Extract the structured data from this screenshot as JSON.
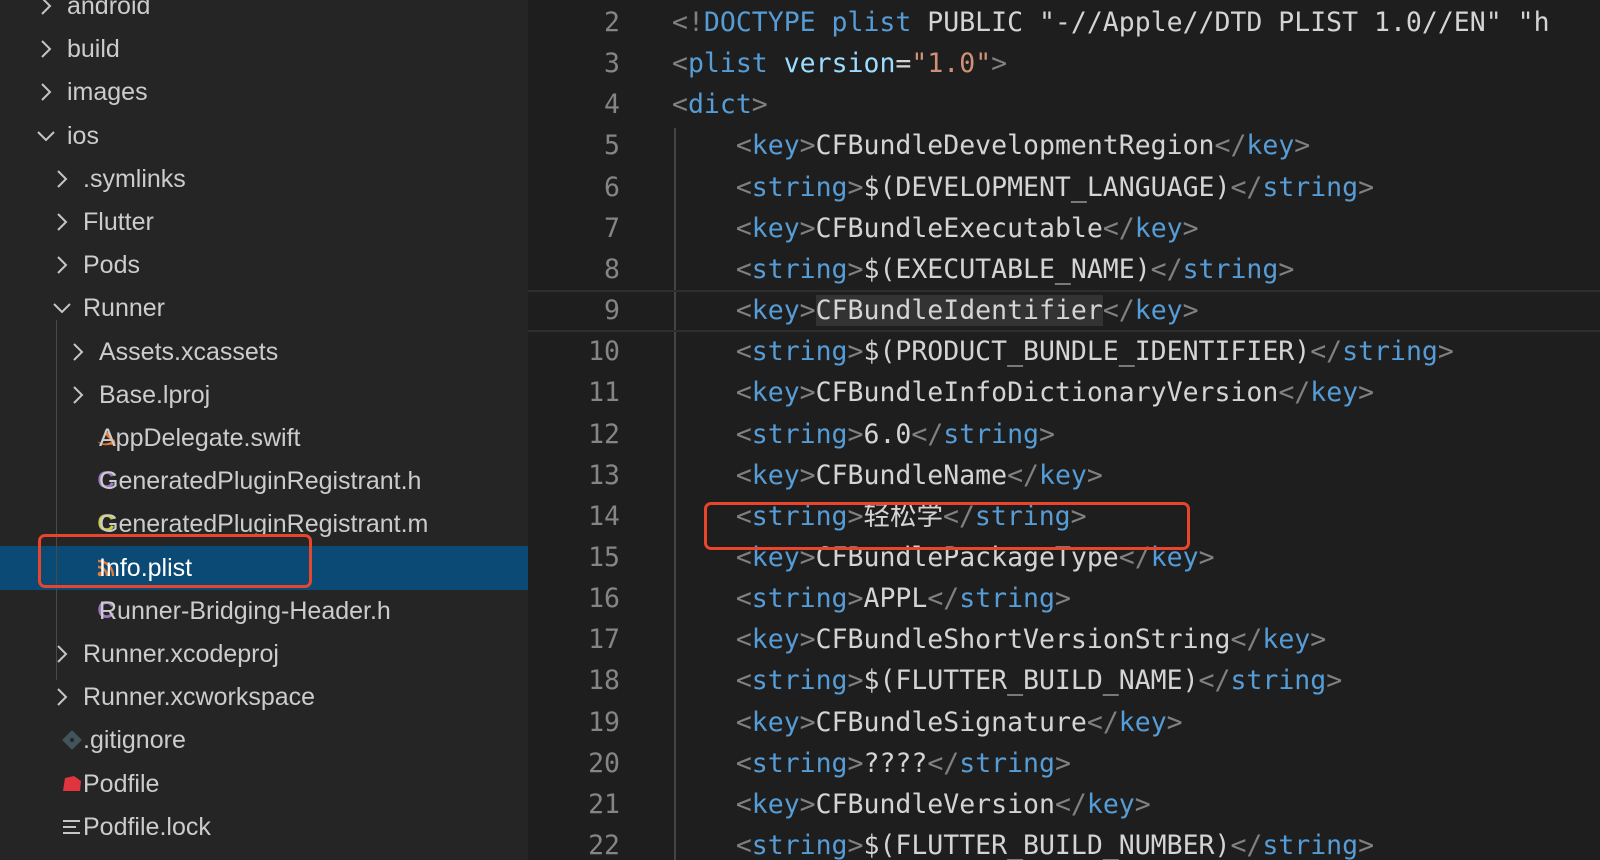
{
  "explorer": {
    "items": [
      {
        "label": "android",
        "kind": "folder",
        "state": "collapsed",
        "depth": 0
      },
      {
        "label": "build",
        "kind": "folder",
        "state": "collapsed",
        "depth": 0
      },
      {
        "label": "images",
        "kind": "folder",
        "state": "collapsed",
        "depth": 0
      },
      {
        "label": "ios",
        "kind": "folder",
        "state": "expanded",
        "depth": 0
      },
      {
        "label": ".symlinks",
        "kind": "folder",
        "state": "collapsed",
        "depth": 1
      },
      {
        "label": "Flutter",
        "kind": "folder",
        "state": "collapsed",
        "depth": 1
      },
      {
        "label": "Pods",
        "kind": "folder",
        "state": "collapsed",
        "depth": 1
      },
      {
        "label": "Runner",
        "kind": "folder",
        "state": "expanded",
        "depth": 1
      },
      {
        "label": "Assets.xcassets",
        "kind": "folder",
        "state": "collapsed",
        "depth": 2
      },
      {
        "label": "Base.lproj",
        "kind": "folder",
        "state": "collapsed",
        "depth": 2
      },
      {
        "label": "AppDelegate.swift",
        "kind": "swift",
        "depth": 2
      },
      {
        "label": "GeneratedPluginRegistrant.h",
        "kind": "c-header",
        "depth": 2
      },
      {
        "label": "GeneratedPluginRegistrant.m",
        "kind": "c-source",
        "depth": 2
      },
      {
        "label": "Info.plist",
        "kind": "plist",
        "depth": 2,
        "selected": true
      },
      {
        "label": "Runner-Bridging-Header.h",
        "kind": "c-header",
        "depth": 2
      },
      {
        "label": "Runner.xcodeproj",
        "kind": "folder",
        "state": "collapsed",
        "depth": 1
      },
      {
        "label": "Runner.xcworkspace",
        "kind": "folder",
        "state": "collapsed",
        "depth": 1
      },
      {
        "label": ".gitignore",
        "kind": "git",
        "depth": 1
      },
      {
        "label": "Podfile",
        "kind": "ruby",
        "depth": 1
      },
      {
        "label": "Podfile.lock",
        "kind": "lines",
        "depth": 1
      }
    ]
  },
  "icons": {
    "chevron_right": "chevron-right-icon",
    "chevron_down": "chevron-down-icon",
    "swift": "swift-icon",
    "c_file": "c-file-icon",
    "rss": "rss-icon",
    "git": "git-icon",
    "ruby": "ruby-icon",
    "lines": "lines-icon"
  },
  "colors": {
    "sidebar_bg": "#252526",
    "editor_bg": "#1e1e1e",
    "selection_bg": "#0a4a75",
    "highlight_box": "#e8452c",
    "tag": "#569cd6",
    "punct": "#808080",
    "text": "#d4d4d4",
    "attr": "#9cdcfe",
    "string": "#ce9178",
    "c_header_icon": "#a074c4",
    "c_source_icon": "#cbcb41",
    "swift_icon": "#e37933",
    "ruby_icon": "#e0343e"
  },
  "editor": {
    "current_line": 9,
    "lines": [
      {
        "n": "2",
        "tokens": [
          {
            "t": "<!",
            "c": "p"
          },
          {
            "t": "DOCTYPE plist",
            "c": "t"
          },
          {
            "t": " PUBLIC \"-//Apple//DTD PLIST 1.0//EN\" \"",
            "c": "tx"
          },
          {
            "t": "h",
            "c": "tx"
          }
        ]
      },
      {
        "n": "3",
        "tokens": [
          {
            "t": "<",
            "c": "p"
          },
          {
            "t": "plist",
            "c": "t"
          },
          {
            "t": " ",
            "c": "tx"
          },
          {
            "t": "version",
            "c": "at"
          },
          {
            "t": "=",
            "c": "tx"
          },
          {
            "t": "\"1.0\"",
            "c": "s"
          },
          {
            "t": ">",
            "c": "p"
          }
        ]
      },
      {
        "n": "4",
        "tokens": [
          {
            "t": "<",
            "c": "p"
          },
          {
            "t": "dict",
            "c": "t"
          },
          {
            "t": ">",
            "c": "p"
          }
        ]
      },
      {
        "n": "5",
        "tokens": [
          {
            "t": "    <",
            "c": "p"
          },
          {
            "t": "key",
            "c": "t"
          },
          {
            "t": ">",
            "c": "p"
          },
          {
            "t": "CFBundleDevelopmentRegion",
            "c": "tx"
          },
          {
            "t": "</",
            "c": "p"
          },
          {
            "t": "key",
            "c": "t"
          },
          {
            "t": ">",
            "c": "p"
          }
        ]
      },
      {
        "n": "6",
        "tokens": [
          {
            "t": "    <",
            "c": "p"
          },
          {
            "t": "string",
            "c": "t"
          },
          {
            "t": ">",
            "c": "p"
          },
          {
            "t": "$(DEVELOPMENT_LANGUAGE)",
            "c": "tx"
          },
          {
            "t": "</",
            "c": "p"
          },
          {
            "t": "string",
            "c": "t"
          },
          {
            "t": ">",
            "c": "p"
          }
        ]
      },
      {
        "n": "7",
        "tokens": [
          {
            "t": "    <",
            "c": "p"
          },
          {
            "t": "key",
            "c": "t"
          },
          {
            "t": ">",
            "c": "p"
          },
          {
            "t": "CFBundleExecutable",
            "c": "tx"
          },
          {
            "t": "</",
            "c": "p"
          },
          {
            "t": "key",
            "c": "t"
          },
          {
            "t": ">",
            "c": "p"
          }
        ]
      },
      {
        "n": "8",
        "tokens": [
          {
            "t": "    <",
            "c": "p"
          },
          {
            "t": "string",
            "c": "t"
          },
          {
            "t": ">",
            "c": "p"
          },
          {
            "t": "$(EXECUTABLE_NAME)",
            "c": "tx"
          },
          {
            "t": "</",
            "c": "p"
          },
          {
            "t": "string",
            "c": "t"
          },
          {
            "t": ">",
            "c": "p"
          }
        ]
      },
      {
        "n": "9",
        "tokens": [
          {
            "t": "    <",
            "c": "p"
          },
          {
            "t": "key",
            "c": "t"
          },
          {
            "t": ">",
            "c": "p"
          },
          {
            "t": "CFBundleIdentifier",
            "c": "tx",
            "sel": true
          },
          {
            "t": "</",
            "c": "p"
          },
          {
            "t": "key",
            "c": "t"
          },
          {
            "t": ">",
            "c": "p"
          }
        ]
      },
      {
        "n": "10",
        "tokens": [
          {
            "t": "    <",
            "c": "p"
          },
          {
            "t": "string",
            "c": "t"
          },
          {
            "t": ">",
            "c": "p"
          },
          {
            "t": "$(PRODUCT_BUNDLE_IDENTIFIER)",
            "c": "tx"
          },
          {
            "t": "</",
            "c": "p"
          },
          {
            "t": "string",
            "c": "t"
          },
          {
            "t": ">",
            "c": "p"
          }
        ]
      },
      {
        "n": "11",
        "tokens": [
          {
            "t": "    <",
            "c": "p"
          },
          {
            "t": "key",
            "c": "t"
          },
          {
            "t": ">",
            "c": "p"
          },
          {
            "t": "CFBundleInfoDictionaryVersion",
            "c": "tx"
          },
          {
            "t": "</",
            "c": "p"
          },
          {
            "t": "key",
            "c": "t"
          },
          {
            "t": ">",
            "c": "p"
          }
        ]
      },
      {
        "n": "12",
        "tokens": [
          {
            "t": "    <",
            "c": "p"
          },
          {
            "t": "string",
            "c": "t"
          },
          {
            "t": ">",
            "c": "p"
          },
          {
            "t": "6.0",
            "c": "tx"
          },
          {
            "t": "</",
            "c": "p"
          },
          {
            "t": "string",
            "c": "t"
          },
          {
            "t": ">",
            "c": "p"
          }
        ]
      },
      {
        "n": "13",
        "tokens": [
          {
            "t": "    <",
            "c": "p"
          },
          {
            "t": "key",
            "c": "t"
          },
          {
            "t": ">",
            "c": "p"
          },
          {
            "t": "CFBundleName",
            "c": "tx"
          },
          {
            "t": "</",
            "c": "p"
          },
          {
            "t": "key",
            "c": "t"
          },
          {
            "t": ">",
            "c": "p"
          }
        ]
      },
      {
        "n": "14",
        "tokens": [
          {
            "t": "    <",
            "c": "p"
          },
          {
            "t": "string",
            "c": "t"
          },
          {
            "t": ">",
            "c": "p"
          },
          {
            "t": "轻松学",
            "c": "tx"
          },
          {
            "t": "</",
            "c": "p"
          },
          {
            "t": "string",
            "c": "t"
          },
          {
            "t": ">",
            "c": "p"
          }
        ]
      },
      {
        "n": "15",
        "tokens": [
          {
            "t": "    <",
            "c": "p"
          },
          {
            "t": "key",
            "c": "t"
          },
          {
            "t": ">",
            "c": "p"
          },
          {
            "t": "CFBundlePackageType",
            "c": "tx"
          },
          {
            "t": "</",
            "c": "p"
          },
          {
            "t": "key",
            "c": "t"
          },
          {
            "t": ">",
            "c": "p"
          }
        ]
      },
      {
        "n": "16",
        "tokens": [
          {
            "t": "    <",
            "c": "p"
          },
          {
            "t": "string",
            "c": "t"
          },
          {
            "t": ">",
            "c": "p"
          },
          {
            "t": "APPL",
            "c": "tx"
          },
          {
            "t": "</",
            "c": "p"
          },
          {
            "t": "string",
            "c": "t"
          },
          {
            "t": ">",
            "c": "p"
          }
        ]
      },
      {
        "n": "17",
        "tokens": [
          {
            "t": "    <",
            "c": "p"
          },
          {
            "t": "key",
            "c": "t"
          },
          {
            "t": ">",
            "c": "p"
          },
          {
            "t": "CFBundleShortVersionString",
            "c": "tx"
          },
          {
            "t": "</",
            "c": "p"
          },
          {
            "t": "key",
            "c": "t"
          },
          {
            "t": ">",
            "c": "p"
          }
        ]
      },
      {
        "n": "18",
        "tokens": [
          {
            "t": "    <",
            "c": "p"
          },
          {
            "t": "string",
            "c": "t"
          },
          {
            "t": ">",
            "c": "p"
          },
          {
            "t": "$(FLUTTER_BUILD_NAME)",
            "c": "tx"
          },
          {
            "t": "</",
            "c": "p"
          },
          {
            "t": "string",
            "c": "t"
          },
          {
            "t": ">",
            "c": "p"
          }
        ]
      },
      {
        "n": "19",
        "tokens": [
          {
            "t": "    <",
            "c": "p"
          },
          {
            "t": "key",
            "c": "t"
          },
          {
            "t": ">",
            "c": "p"
          },
          {
            "t": "CFBundleSignature",
            "c": "tx"
          },
          {
            "t": "</",
            "c": "p"
          },
          {
            "t": "key",
            "c": "t"
          },
          {
            "t": ">",
            "c": "p"
          }
        ]
      },
      {
        "n": "20",
        "tokens": [
          {
            "t": "    <",
            "c": "p"
          },
          {
            "t": "string",
            "c": "t"
          },
          {
            "t": ">",
            "c": "p"
          },
          {
            "t": "????",
            "c": "tx"
          },
          {
            "t": "</",
            "c": "p"
          },
          {
            "t": "string",
            "c": "t"
          },
          {
            "t": ">",
            "c": "p"
          }
        ]
      },
      {
        "n": "21",
        "tokens": [
          {
            "t": "    <",
            "c": "p"
          },
          {
            "t": "key",
            "c": "t"
          },
          {
            "t": ">",
            "c": "p"
          },
          {
            "t": "CFBundleVersion",
            "c": "tx"
          },
          {
            "t": "</",
            "c": "p"
          },
          {
            "t": "key",
            "c": "t"
          },
          {
            "t": ">",
            "c": "p"
          }
        ]
      },
      {
        "n": "22",
        "tokens": [
          {
            "t": "    <",
            "c": "p"
          },
          {
            "t": "string",
            "c": "t"
          },
          {
            "t": ">",
            "c": "p"
          },
          {
            "t": "$(FLUTTER_BUILD_NUMBER)",
            "c": "tx"
          },
          {
            "t": "</",
            "c": "p"
          },
          {
            "t": "string",
            "c": "t"
          },
          {
            "t": ">",
            "c": "p"
          }
        ]
      }
    ]
  }
}
